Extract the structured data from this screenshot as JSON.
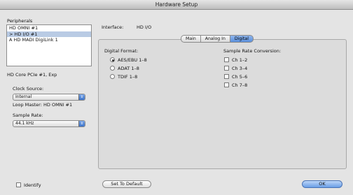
{
  "window": {
    "title": "Hardware Setup"
  },
  "peripherals": {
    "label": "Peripherals",
    "items": [
      "HD OMNI #1",
      "> HD I/O #1",
      "A HD MADI DigiLink 1"
    ],
    "selected_index": 1
  },
  "device": {
    "name": "HD Core PCIe #1, Exp"
  },
  "clock": {
    "label": "Clock Source:",
    "value": "Internal",
    "loop_master": "Loop Master: HD OMNI #1"
  },
  "sample_rate": {
    "label": "Sample Rate:",
    "value": "44.1 kHz"
  },
  "interface": {
    "label": "Interface:",
    "value": "HD I/O"
  },
  "tabs": [
    {
      "label": "Main",
      "active": false
    },
    {
      "label": "Analog In",
      "active": false
    },
    {
      "label": "Digital",
      "active": true
    }
  ],
  "digital_format": {
    "label": "Digital Format:",
    "options": [
      {
        "label": "AES/EBU 1–8",
        "selected": true
      },
      {
        "label": "ADAT 1–8",
        "selected": false
      },
      {
        "label": "TDIF 1–8",
        "selected": false
      }
    ]
  },
  "src": {
    "label": "Sample Rate Conversion:",
    "channels": [
      {
        "label": "Ch 1–2",
        "checked": false
      },
      {
        "label": "Ch 3–4",
        "checked": false
      },
      {
        "label": "Ch 5–6",
        "checked": false
      },
      {
        "label": "Ch 7–8",
        "checked": false
      }
    ]
  },
  "footer": {
    "identify": "Identify",
    "set_default": "Set To Default",
    "ok": "OK"
  },
  "colors": {
    "selection": "#b9cbe4",
    "accent_blue": "#5a8fdc"
  },
  "icons": {
    "popup_arrow": "up-down-arrows-icon"
  }
}
